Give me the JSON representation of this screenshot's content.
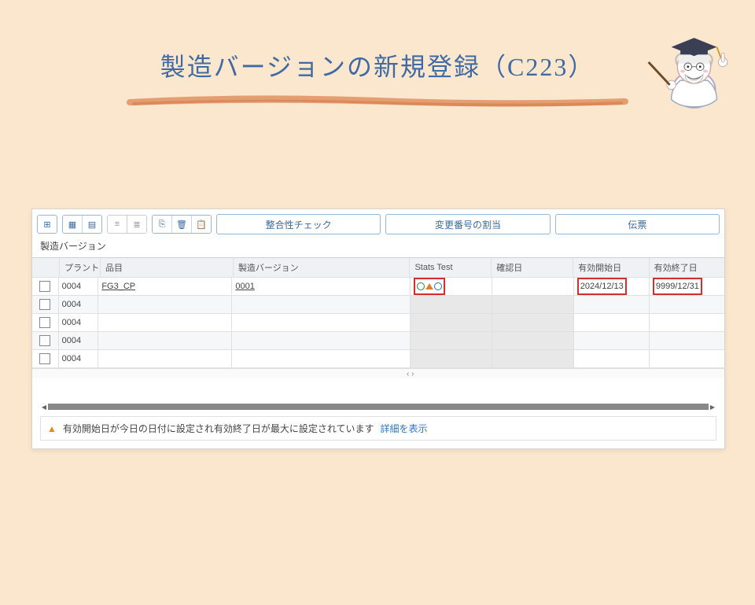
{
  "page_title": "製造バージョンの新規登録（C223）",
  "toolbar": {
    "check_consistency": "整合性チェック",
    "assign_change_number": "変更番号の割当",
    "slip": "伝票"
  },
  "section_label": "製造バージョン",
  "columns": {
    "plant": "プラント",
    "item": "品目",
    "version": "製造バージョン",
    "stats": "Stats Test",
    "confirm_date": "確認日",
    "valid_from": "有効開始日",
    "valid_to": "有効終了日"
  },
  "rows": [
    {
      "plant": "0004",
      "item": "FG3_CP",
      "version": "0001",
      "stats": true,
      "valid_from": "2024/12/13",
      "valid_to": "9999/12/31"
    },
    {
      "plant": "0004"
    },
    {
      "plant": "0004"
    },
    {
      "plant": "0004"
    },
    {
      "plant": "0004"
    }
  ],
  "status": {
    "message": "有効開始日が今日の日付に設定され有効終了日が最大に設定されています",
    "link": "詳細を表示"
  },
  "icons": {
    "insert_row": "⊞",
    "layout1": "▦",
    "layout2": "▤",
    "sort_asc": "≡",
    "sort_desc": "≣",
    "copy": "⎘",
    "delete": "🗑",
    "paste": "📋"
  },
  "scroll_hint": "‹  ›"
}
